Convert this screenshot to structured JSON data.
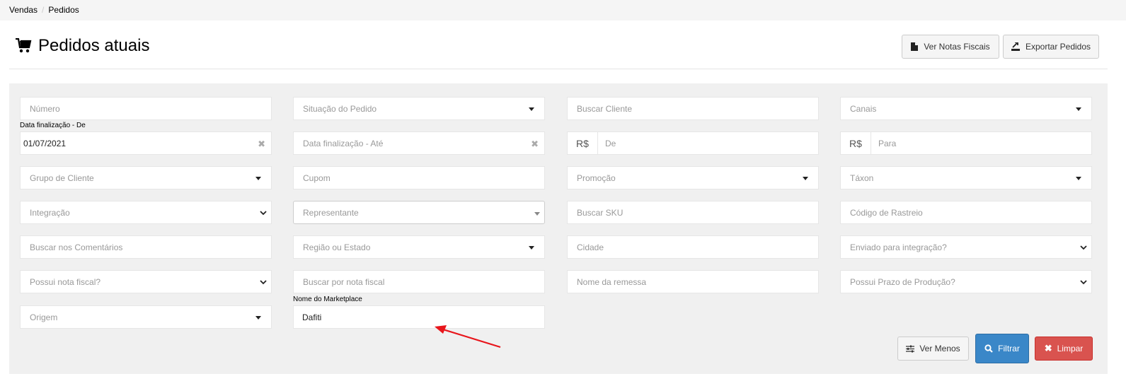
{
  "breadcrumb": {
    "item1": "Vendas",
    "item2": "Pedidos"
  },
  "header": {
    "title": "Pedidos atuais",
    "btn_notas": "Ver Notas Fiscais",
    "btn_exportar": "Exportar Pedidos"
  },
  "filters": {
    "numero": "Número",
    "situacao": "Situação do Pedido",
    "buscar_cliente": "Buscar Cliente",
    "canais": "Canais",
    "data_de_label": "Data finalização - De",
    "data_de_value": "01/07/2021",
    "data_ate": "Data finalização - Até",
    "currency": "R$",
    "valor_de": "De",
    "valor_para": "Para",
    "grupo_cliente": "Grupo de Cliente",
    "cupom": "Cupom",
    "promocao": "Promoção",
    "taxon": "Táxon",
    "integracao": "Integração",
    "representante": "Representante",
    "buscar_sku": "Buscar SKU",
    "codigo_rastreio": "Código de Rastreio",
    "buscar_comentarios": "Buscar nos Comentários",
    "regiao_estado": "Região ou Estado",
    "cidade": "Cidade",
    "enviado_integracao": "Enviado para integração?",
    "possui_nota": "Possui nota fiscal?",
    "buscar_nota": "Buscar por nota fiscal",
    "nome_remessa": "Nome da remessa",
    "possui_prazo": "Possui Prazo de Produção?",
    "origem": "Origem",
    "marketplace_label": "Nome do Marketplace",
    "marketplace_value": "Dafiti"
  },
  "actions": {
    "ver_menos": "Ver Menos",
    "filtrar": "Filtrar",
    "limpar": "Limpar"
  },
  "colors": {
    "primary": "#3a87c8",
    "danger": "#d9534f",
    "annotation": "#e8151b"
  }
}
